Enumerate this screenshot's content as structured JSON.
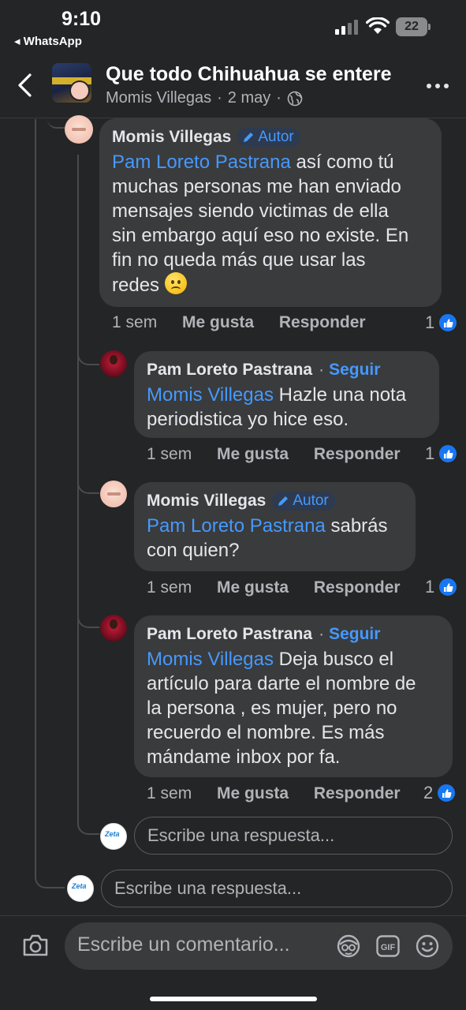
{
  "status_bar": {
    "time": "9:10",
    "back_app": "◂ WhatsApp",
    "battery": "22"
  },
  "header": {
    "title": "Que todo Chihuahua se entere",
    "author": "Momis Villegas",
    "separator": "·",
    "date": "2 may",
    "separator2": "·"
  },
  "comments": [
    {
      "name": "Momis Villegas",
      "badge": "Autor",
      "mention": "Pam Loreto Pastrana",
      "text_lines": [
        " así como tú",
        "muchas personas me han enviado",
        "mensajes siendo victimas de ella",
        "sin embargo aquí eso no existe. En",
        "fin no queda más que usar las",
        "redes "
      ],
      "time": "1 sem",
      "like_label": "Me gusta",
      "reply_label": "Responder",
      "likes": "1"
    },
    {
      "name": "Pam Loreto Pastrana",
      "separator": "·",
      "follow": "Seguir",
      "mention": "Momis Villegas",
      "text_lines": [
        " Hazle una nota",
        "periodistica yo hice eso."
      ],
      "time": "1 sem",
      "like_label": "Me gusta",
      "reply_label": "Responder",
      "likes": "1"
    },
    {
      "name": "Momis Villegas",
      "badge": "Autor",
      "mention": "Pam Loreto Pastrana",
      "text_lines": [
        " sabrás",
        "con quien?"
      ],
      "time": "1 sem",
      "like_label": "Me gusta",
      "reply_label": "Responder",
      "likes": "1"
    },
    {
      "name": "Pam Loreto Pastrana",
      "separator": "·",
      "follow": "Seguir",
      "mention": "Momis Villegas",
      "text_lines": [
        " Deja busco el",
        "artículo para darte el nombre de",
        "la persona , es mujer, pero no",
        "recuerdo el nombre. Es más",
        "mándame inbox por fa."
      ],
      "time": "1 sem",
      "like_label": "Me gusta",
      "reply_label": "Responder",
      "likes": "2"
    }
  ],
  "reply_inputs": {
    "nested_placeholder": "Escribe una respuesta...",
    "outer_placeholder": "Escribe una respuesta..."
  },
  "composer": {
    "placeholder": "Escribe un comentario..."
  },
  "colors": {
    "background": "#242526",
    "bubble": "#3a3b3c",
    "accent": "#4599ff",
    "like": "#1877f2"
  }
}
